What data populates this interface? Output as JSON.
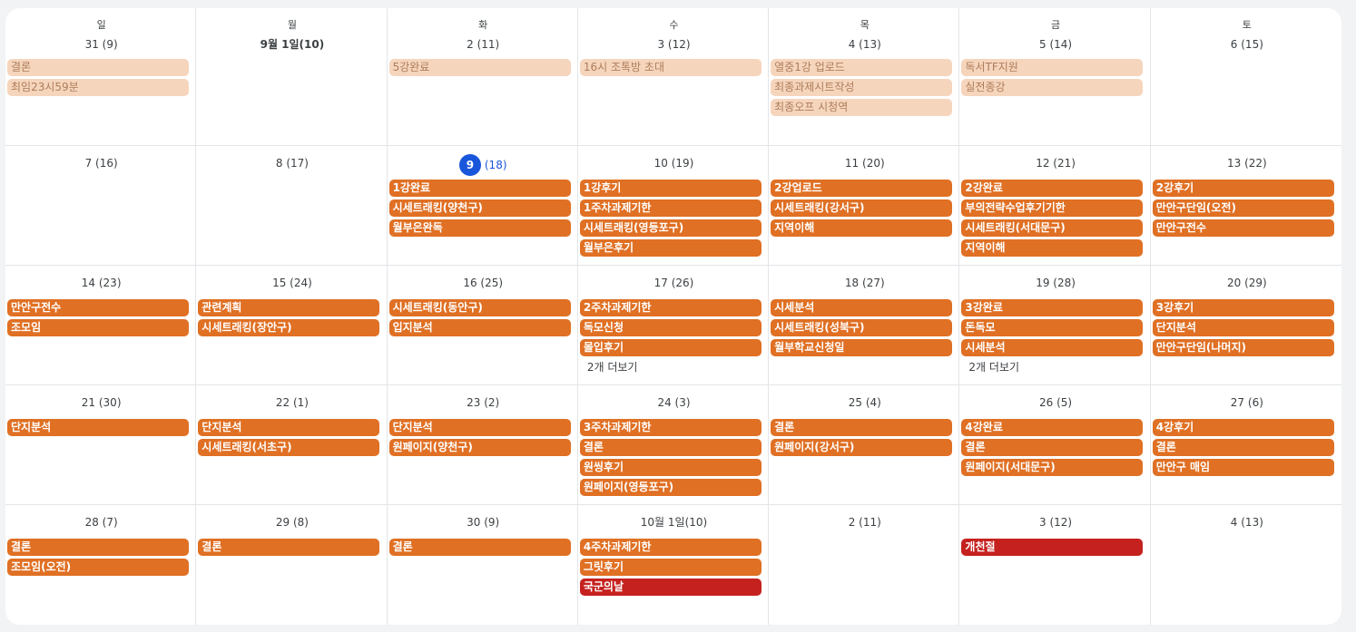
{
  "weekdays": [
    "일",
    "월",
    "화",
    "수",
    "목",
    "금",
    "토"
  ],
  "weeks": [
    [
      {
        "label": "31 (9)",
        "events": [
          {
            "t": "결론",
            "c": "past"
          },
          {
            "t": "최임23시59분",
            "c": "past"
          }
        ]
      },
      {
        "label": "9월 1일(10)",
        "bold": true,
        "events": []
      },
      {
        "label": "2  (11)",
        "events": [
          {
            "t": "5강완료",
            "c": "past"
          }
        ]
      },
      {
        "label": "3  (12)",
        "events": [
          {
            "t": "16시 조톡방 초대",
            "c": "past"
          }
        ]
      },
      {
        "label": "4  (13)",
        "events": [
          {
            "t": "열중1강 업로드",
            "c": "past"
          },
          {
            "t": "최종과제시트작성",
            "c": "past"
          },
          {
            "t": "최종오프 시청역",
            "c": "past"
          }
        ]
      },
      {
        "label": "5  (14)",
        "events": [
          {
            "t": "독서TF지원",
            "c": "past"
          },
          {
            "t": "실전종강",
            "c": "past"
          }
        ]
      },
      {
        "label": "6  (15)",
        "events": []
      }
    ],
    [
      {
        "label": "7  (16)",
        "events": []
      },
      {
        "label": "8  (17)",
        "events": []
      },
      {
        "today": true,
        "num": "9",
        "sub": "(18)",
        "events": [
          {
            "t": "1강완료",
            "c": "orange"
          },
          {
            "t": "시세트래킹(양천구)",
            "c": "orange"
          },
          {
            "t": "월부은완독",
            "c": "orange"
          }
        ]
      },
      {
        "label": "10  (19)",
        "events": [
          {
            "t": "1강후기",
            "c": "orange"
          },
          {
            "t": "1주차과제기한",
            "c": "orange"
          },
          {
            "t": "시세트래킹(영등포구)",
            "c": "orange"
          },
          {
            "t": "월부은후기",
            "c": "orange"
          }
        ]
      },
      {
        "label": "11  (20)",
        "events": [
          {
            "t": "2강업로드",
            "c": "orange"
          },
          {
            "t": "시세트래킹(강서구)",
            "c": "orange"
          },
          {
            "t": "지역이해",
            "c": "orange"
          }
        ]
      },
      {
        "label": "12  (21)",
        "events": [
          {
            "t": "2강완료",
            "c": "orange"
          },
          {
            "t": "부의전략수업후기기한",
            "c": "orange"
          },
          {
            "t": "시세트래킹(서대문구)",
            "c": "orange"
          },
          {
            "t": "지역이해",
            "c": "orange"
          }
        ]
      },
      {
        "label": "13  (22)",
        "events": [
          {
            "t": "2강후기",
            "c": "orange"
          },
          {
            "t": "만안구단임(오전)",
            "c": "orange"
          },
          {
            "t": "만안구전수",
            "c": "orange"
          }
        ]
      }
    ],
    [
      {
        "label": "14  (23)",
        "events": [
          {
            "t": "만안구전수",
            "c": "orange"
          },
          {
            "t": "조모임",
            "c": "orange"
          }
        ]
      },
      {
        "label": "15  (24)",
        "events": [
          {
            "t": "관련계획",
            "c": "orange"
          },
          {
            "t": "시세트래킹(장안구)",
            "c": "orange"
          }
        ]
      },
      {
        "label": "16  (25)",
        "events": [
          {
            "t": "시세트래킹(동안구)",
            "c": "orange"
          },
          {
            "t": "입지분석",
            "c": "orange"
          }
        ]
      },
      {
        "label": "17  (26)",
        "more": "2개 더보기",
        "events": [
          {
            "t": "2주차과제기한",
            "c": "orange"
          },
          {
            "t": "독모신청",
            "c": "orange"
          },
          {
            "t": "몰입후기",
            "c": "orange"
          }
        ]
      },
      {
        "label": "18  (27)",
        "events": [
          {
            "t": "시세분석",
            "c": "orange"
          },
          {
            "t": "시세트래킹(성북구)",
            "c": "orange"
          },
          {
            "t": "월부학교신청일",
            "c": "orange"
          }
        ]
      },
      {
        "label": "19  (28)",
        "more": "2개 더보기",
        "events": [
          {
            "t": "3강완료",
            "c": "orange"
          },
          {
            "t": "돈독모",
            "c": "orange"
          },
          {
            "t": "시세분석",
            "c": "orange"
          }
        ]
      },
      {
        "label": "20 (29)",
        "events": [
          {
            "t": "3강후기",
            "c": "orange"
          },
          {
            "t": "단지분석",
            "c": "orange"
          },
          {
            "t": "만안구단임(나머지)",
            "c": "orange"
          }
        ]
      }
    ],
    [
      {
        "label": "21 (30)",
        "events": [
          {
            "t": "단지분석",
            "c": "orange"
          }
        ]
      },
      {
        "label": "22 (1)",
        "events": [
          {
            "t": "단지분석",
            "c": "orange"
          },
          {
            "t": "시세트래킹(서초구)",
            "c": "orange"
          }
        ]
      },
      {
        "label": "23 (2)",
        "events": [
          {
            "t": "단지분석",
            "c": "orange"
          },
          {
            "t": "원페이지(양천구)",
            "c": "orange"
          }
        ]
      },
      {
        "label": "24 (3)",
        "events": [
          {
            "t": "3주차과제기한",
            "c": "orange"
          },
          {
            "t": "결론",
            "c": "orange"
          },
          {
            "t": "원씽후기",
            "c": "orange"
          },
          {
            "t": "원페이지(영등포구)",
            "c": "orange"
          }
        ]
      },
      {
        "label": "25 (4)",
        "events": [
          {
            "t": "결론",
            "c": "orange"
          },
          {
            "t": "원페이지(강서구)",
            "c": "orange"
          }
        ]
      },
      {
        "label": "26 (5)",
        "events": [
          {
            "t": "4강완료",
            "c": "orange"
          },
          {
            "t": "결론",
            "c": "orange"
          },
          {
            "t": "원페이지(서대문구)",
            "c": "orange"
          }
        ]
      },
      {
        "label": "27 (6)",
        "events": [
          {
            "t": "4강후기",
            "c": "orange"
          },
          {
            "t": "결론",
            "c": "orange"
          },
          {
            "t": "만안구 매임",
            "c": "orange"
          }
        ]
      }
    ],
    [
      {
        "label": "28 (7)",
        "events": [
          {
            "t": "결론",
            "c": "orange"
          },
          {
            "t": "조모임(오전)",
            "c": "orange"
          }
        ]
      },
      {
        "label": "29 (8)",
        "events": [
          {
            "t": "결론",
            "c": "orange"
          }
        ]
      },
      {
        "label": "30 (9)",
        "events": [
          {
            "t": "결론",
            "c": "orange"
          }
        ]
      },
      {
        "label": "10월 1일(10)",
        "events": [
          {
            "t": "4주차과제기한",
            "c": "orange"
          },
          {
            "t": "그릿후기",
            "c": "orange"
          },
          {
            "t": "국군의날",
            "c": "red"
          }
        ]
      },
      {
        "label": "2  (11)",
        "events": []
      },
      {
        "label": "3  (12)",
        "events": [
          {
            "t": "개천절",
            "c": "red"
          }
        ]
      },
      {
        "label": "4  (13)",
        "events": []
      }
    ]
  ],
  "colors": {
    "accent": "#1a56db",
    "event_orange": "#e07024",
    "event_past": "#f6d5bd",
    "holiday_red": "#c5221f"
  }
}
